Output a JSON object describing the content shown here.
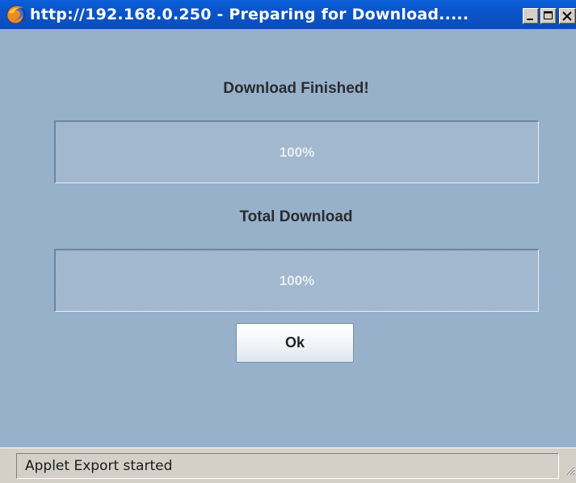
{
  "window": {
    "title": "http://192.168.0.250 - Preparing for Download.....",
    "title_icon": "firefox-icon",
    "controls": {
      "minimize_icon": "minimize-icon",
      "maximize_icon": "maximize-icon",
      "close_icon": "close-icon"
    }
  },
  "dialog": {
    "file_heading": "Download Finished!",
    "file_progress": {
      "label": "100%",
      "value": 1.0
    },
    "total_heading": "Total Download",
    "total_progress": {
      "label": "100%",
      "value": 1.0
    },
    "ok_label": "Ok"
  },
  "statusbar": {
    "text": "Applet Export started",
    "grip_icon": "resize-grip-icon"
  },
  "colors": {
    "titlebar": "#0b54c9",
    "content_background": "#97b1cb",
    "progress_background": "#a0b7ce",
    "chrome": "#d4d0c8"
  }
}
